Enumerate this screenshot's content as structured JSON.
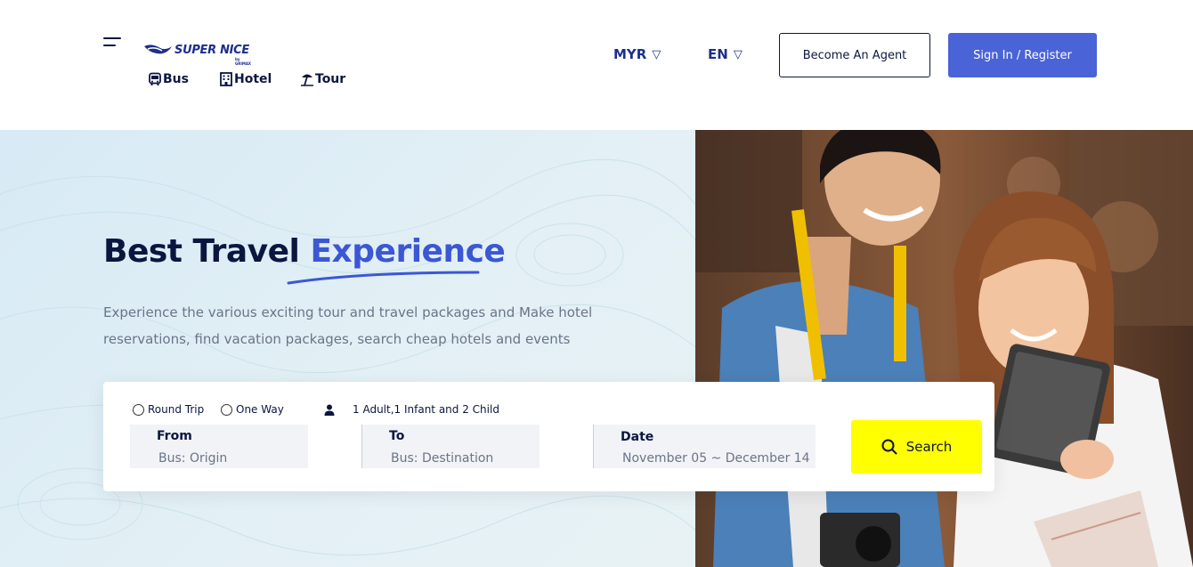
{
  "header": {
    "logo_text": "SUPER NICE",
    "logo_sub": "by GRIMAX",
    "nav": [
      {
        "label": "Bus",
        "icon": "bus-icon"
      },
      {
        "label": "Hotel",
        "icon": "hotel-icon"
      },
      {
        "label": "Tour",
        "icon": "tour-icon"
      }
    ],
    "currency": "MYR",
    "language": "EN",
    "agent_button": "Become An Agent",
    "signin_button": "Sign In / Register"
  },
  "hero": {
    "headline_prefix": "Best Travel",
    "headline_accent": "Experience",
    "subtext": "Experience the various exciting tour and travel packages and Make hotel reservations, find vacation packages, search cheap hotels and events"
  },
  "search": {
    "trip_types": [
      "Round Trip",
      "One Way"
    ],
    "passengers": "1 Adult,1 Infant and 2 Child",
    "from": {
      "label": "From",
      "placeholder": "Bus: Origin"
    },
    "to": {
      "label": "To",
      "placeholder": "Bus: Destination"
    },
    "date": {
      "label": "Date",
      "value": "November 05 ~ December 14"
    },
    "button": "Search"
  },
  "colors": {
    "brand": "#1d2f8c",
    "accent": "#3c57d4",
    "signin": "#4a63d6",
    "search_button": "#ffff00",
    "navy": "#0b1640"
  }
}
